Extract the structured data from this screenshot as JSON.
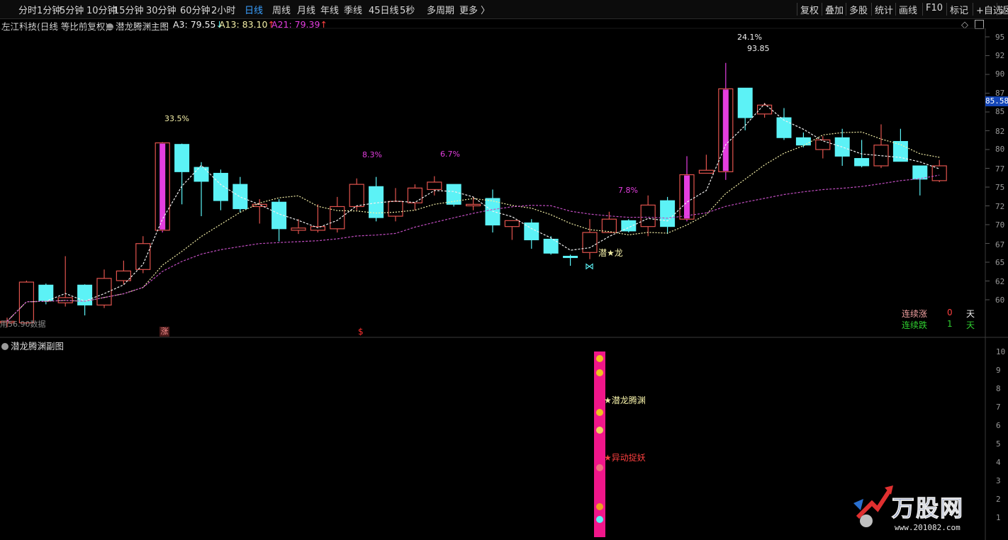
{
  "toolbar": {
    "left_tabs": [
      "分时",
      "1分钟",
      "5分钟",
      "10分钟",
      "15分钟",
      "30分钟",
      "60分钟",
      "2小时",
      "日线",
      "周线",
      "月线",
      "年线",
      "季线",
      "45日线",
      "5秒",
      "多周期",
      "更多 〉"
    ],
    "active_tab": "日线",
    "right_buttons": [
      "复权",
      "叠加",
      "多股",
      "统计",
      "画线",
      "F10",
      "标记",
      "+自选",
      "返"
    ]
  },
  "main_header": {
    "stock": "左江科技(日线 等比前复权)",
    "indicator": "潜龙腾渊主图",
    "a3": "A3: 79.55",
    "a3_arrow": "↓",
    "a13": "A13: 83.10",
    "a13_arrow": "↑",
    "a21": "A21: 79.39",
    "a21_arrow": "↑"
  },
  "sub_header": {
    "indicator": "潜龙腾渊副图"
  },
  "price_axis": [
    "95",
    "92",
    "90",
    "87",
    "85",
    "82",
    "80",
    "77",
    "75",
    "72",
    "70",
    "67",
    "65",
    "62",
    "60"
  ],
  "current_price": "85.58",
  "sub_axis": [
    "10",
    "9",
    "8",
    "7",
    "6",
    "5",
    "4",
    "3",
    "2",
    "1"
  ],
  "annotations": {
    "peak1_pct": "33.5%",
    "pct2": "8.3%",
    "pct3": "6.7%",
    "pct4": "7.8%",
    "peak2_pct": "24.1%",
    "peak2_price": "93.85",
    "low_price": "56.90",
    "low_prefix": "用",
    "low_suffix": "数据",
    "signal_label": "潜★龙",
    "zhang_mark": "涨",
    "dollar_mark": "$",
    "sub_label1": "★潜龙腾渊",
    "sub_label2": "★异动捉妖"
  },
  "streak": {
    "up_label": "连续涨",
    "up_count": "0",
    "down_label": "连续跌",
    "down_count": "1",
    "unit": "天"
  },
  "watermark": {
    "brand": "万股网",
    "url": "www.201082.com"
  },
  "colors": {
    "up": "#e0534d",
    "down": "#5cf2f6",
    "magenta": "#e43ee0",
    "ma_fast": "#f0f0f0",
    "ma_mid": "#f5f0a8",
    "ma_slow": "#c04dc0",
    "sub_bar": "#f0168a",
    "active_tab": "#3aa0ff"
  },
  "chart_data": {
    "type": "candlestick",
    "price_range": [
      57.5,
      96
    ],
    "candles": [
      {
        "o": 58.8,
        "h": 59.5,
        "l": 58.2,
        "c": 59.0
      },
      {
        "o": 58.8,
        "h": 64.5,
        "l": 58.6,
        "c": 64.3
      },
      {
        "o": 63.9,
        "h": 64.1,
        "l": 61.3,
        "c": 61.8
      },
      {
        "o": 61.5,
        "h": 67.8,
        "l": 61.0,
        "c": 62.2
      },
      {
        "o": 63.9,
        "h": 64.0,
        "l": 59.8,
        "c": 61.2
      },
      {
        "o": 61.2,
        "h": 66.0,
        "l": 60.8,
        "c": 64.8
      },
      {
        "o": 64.5,
        "h": 67.2,
        "l": 64.0,
        "c": 65.8
      },
      {
        "o": 66.0,
        "h": 70.5,
        "l": 65.5,
        "c": 69.5
      },
      {
        "o": 71.3,
        "h": 83.2,
        "l": 71.0,
        "c": 83.1
      },
      {
        "o": 82.9,
        "h": 83.0,
        "l": 74.8,
        "c": 79.2
      },
      {
        "o": 79.8,
        "h": 80.5,
        "l": 73.2,
        "c": 77.9
      },
      {
        "o": 79.0,
        "h": 79.5,
        "l": 74.0,
        "c": 75.3
      },
      {
        "o": 77.5,
        "h": 78.5,
        "l": 73.7,
        "c": 74.2
      },
      {
        "o": 74.5,
        "h": 75.5,
        "l": 72.2,
        "c": 74.8
      },
      {
        "o": 75.1,
        "h": 75.5,
        "l": 69.8,
        "c": 71.5
      },
      {
        "o": 71.3,
        "h": 72.8,
        "l": 70.8,
        "c": 71.6
      },
      {
        "o": 71.3,
        "h": 74.8,
        "l": 71.0,
        "c": 71.8
      },
      {
        "o": 71.5,
        "h": 75.8,
        "l": 71.0,
        "c": 74.5
      },
      {
        "o": 74.5,
        "h": 78.3,
        "l": 74.0,
        "c": 77.5
      },
      {
        "o": 77.2,
        "h": 78.5,
        "l": 72.5,
        "c": 73.0
      },
      {
        "o": 73.2,
        "h": 77.0,
        "l": 72.5,
        "c": 75.2
      },
      {
        "o": 75.0,
        "h": 77.5,
        "l": 74.0,
        "c": 77.0
      },
      {
        "o": 76.8,
        "h": 78.6,
        "l": 76.0,
        "c": 77.8
      },
      {
        "o": 77.5,
        "h": 77.5,
        "l": 74.5,
        "c": 74.8
      },
      {
        "o": 74.6,
        "h": 75.8,
        "l": 74.0,
        "c": 74.8
      },
      {
        "o": 75.6,
        "h": 76.8,
        "l": 71.0,
        "c": 72.0
      },
      {
        "o": 71.8,
        "h": 72.5,
        "l": 70.0,
        "c": 72.6
      },
      {
        "o": 72.3,
        "h": 72.8,
        "l": 68.8,
        "c": 70.0
      },
      {
        "o": 70.1,
        "h": 70.5,
        "l": 68.0,
        "c": 68.2
      },
      {
        "o": 67.8,
        "h": 68.0,
        "l": 66.5,
        "c": 67.6
      },
      {
        "o": 68.3,
        "h": 72.8,
        "l": 67.4,
        "c": 71.0
      },
      {
        "o": 71.0,
        "h": 73.8,
        "l": 71.0,
        "c": 72.8
      },
      {
        "o": 72.6,
        "h": 72.8,
        "l": 71.0,
        "c": 71.2
      },
      {
        "o": 71.8,
        "h": 76.0,
        "l": 70.5,
        "c": 74.7
      },
      {
        "o": 75.3,
        "h": 75.8,
        "l": 70.8,
        "c": 71.8
      },
      {
        "o": 72.8,
        "h": 81.3,
        "l": 72.5,
        "c": 78.8
      },
      {
        "o": 79.0,
        "h": 81.5,
        "l": 79.0,
        "c": 79.4
      },
      {
        "o": 79.2,
        "h": 93.9,
        "l": 78.1,
        "c": 90.4
      },
      {
        "o": 90.5,
        "h": 90.5,
        "l": 84.8,
        "c": 86.5
      },
      {
        "o": 87.0,
        "h": 88.5,
        "l": 86.5,
        "c": 88.2
      },
      {
        "o": 86.5,
        "h": 87.8,
        "l": 83.5,
        "c": 83.8
      },
      {
        "o": 83.8,
        "h": 84.5,
        "l": 82.5,
        "c": 82.8
      },
      {
        "o": 82.2,
        "h": 84.0,
        "l": 81.0,
        "c": 83.5
      },
      {
        "o": 83.8,
        "h": 85.0,
        "l": 80.0,
        "c": 81.3
      },
      {
        "o": 81.0,
        "h": 83.5,
        "l": 79.8,
        "c": 80.0
      },
      {
        "o": 80.0,
        "h": 85.6,
        "l": 79.7,
        "c": 82.8
      },
      {
        "o": 83.3,
        "h": 85.0,
        "l": 80.8,
        "c": 80.6
      },
      {
        "o": 80.0,
        "h": 80.0,
        "l": 76.0,
        "c": 78.2
      },
      {
        "o": 78.0,
        "h": 80.8,
        "l": 77.8,
        "c": 80.0
      }
    ],
    "highlight_candles": [
      8,
      35,
      37
    ]
  }
}
